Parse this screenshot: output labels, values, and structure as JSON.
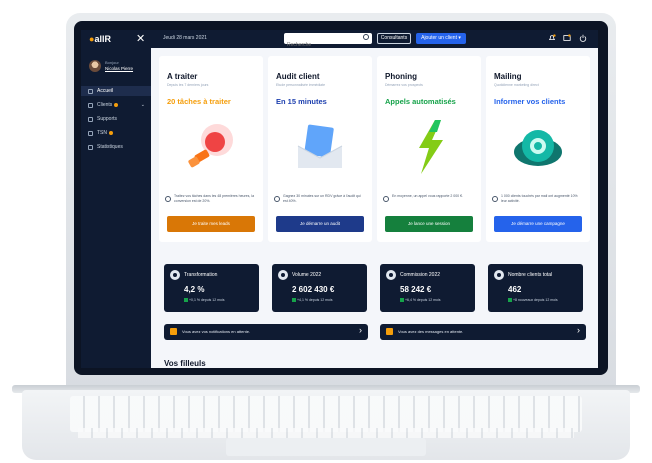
{
  "topbar": {
    "logo": "allR",
    "date": "Jeudi 28 mars 2021",
    "search_placeholder": "Recherche",
    "consultant_label": "Consultants",
    "add_client_label": "Ajouter un client ▾"
  },
  "sidebar": {
    "greeting": "Bonjour",
    "user_name": "Nicolas Pierre",
    "items": [
      {
        "label": "Accueil"
      },
      {
        "label": "Clients"
      },
      {
        "label": "Supports"
      },
      {
        "label": "TSN"
      },
      {
        "label": "Statistiques"
      }
    ]
  },
  "cards": [
    {
      "title": "A traiter",
      "subtitle": "Depuis les 7 derniers jours",
      "highlight": "20 tâches à traiter",
      "desc": "Traitez vos tâches dans les 48 premières heures, la conversion est de 20%.",
      "button": "Je traite mes leads",
      "color": "#f59e0b",
      "btn_color": "#d97706"
    },
    {
      "title": "Audit client",
      "subtitle": "Etude personnalisée immédiate",
      "highlight": "En 15 minutes",
      "desc": "Gagnez 30 minutes sur un RDV grâce à l'audit qui est 40%.",
      "button": "Je démarre un audit",
      "color": "#1e40af",
      "btn_color": "#1e3a8a"
    },
    {
      "title": "Phoning",
      "subtitle": "Démarrez vos prospects",
      "highlight": "Appels automatisés",
      "desc": "En moyenne, un appel vous rapporte 2 000 €.",
      "button": "Je lance une session",
      "color": "#16a34a",
      "btn_color": "#15803d"
    },
    {
      "title": "Mailing",
      "subtitle": "Quotidienne marketing direct",
      "highlight": "Informer vos clients",
      "desc": "1 000 clients touchés par mail ont augmenté 10% leur activité.",
      "button": "Je démarre une campagne",
      "color": "#2563eb",
      "btn_color": "#2563eb"
    }
  ],
  "stats": [
    {
      "label": "Transformation",
      "value": "4,2 %",
      "delta": "+0,1 % depuis 12 mois"
    },
    {
      "label": "Volume 2022",
      "value": "2 602 430 €",
      "delta": "+4,1 % depuis 12 mois"
    },
    {
      "label": "Commission 2022",
      "value": "58 242 €",
      "delta": "+6,4 % depuis 12 mois"
    },
    {
      "label": "Nombre clients total",
      "value": "462",
      "delta": "+8 nouveaux depuis 12 mois"
    }
  ],
  "notifications": [
    {
      "text": "Vous avez vos notifications en attente.",
      "color": "#f59e0b"
    },
    {
      "text": "Vous avez des messages en attente.",
      "color": "#f59e0b"
    }
  ],
  "section_title": "Vos filleuls"
}
